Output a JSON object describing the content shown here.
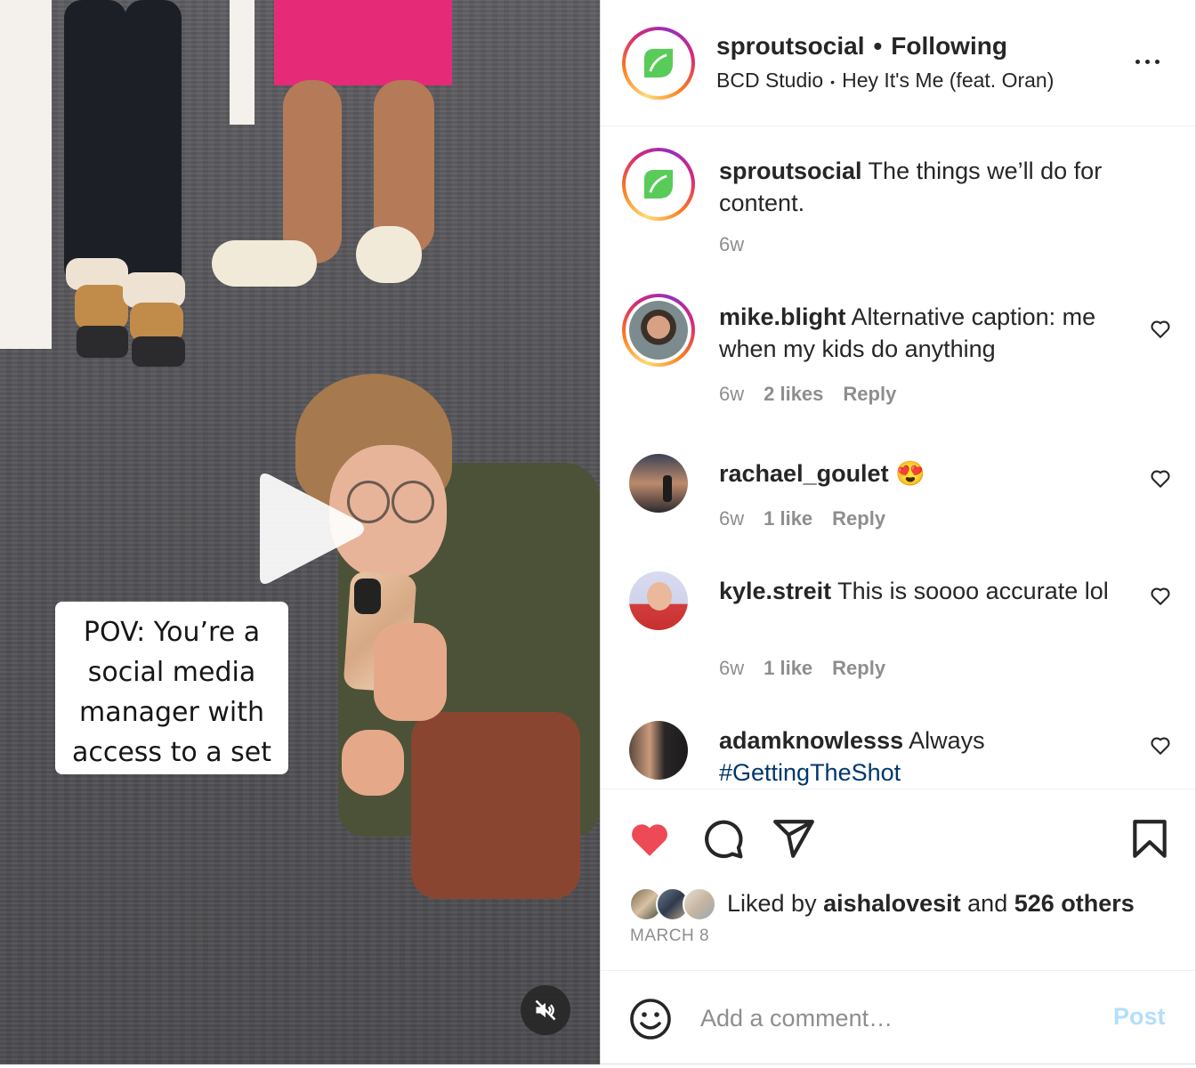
{
  "media": {
    "overlay_text": "POV: You’re a social media manager with access to a set",
    "play_icon": "play-icon",
    "mute_icon": "muted-speaker-icon"
  },
  "header": {
    "username": "sproutsocial",
    "separator": "•",
    "follow_status": "Following",
    "audio_artist": "BCD Studio",
    "audio_separator": "•",
    "audio_title": "Hey It's Me (feat. Oran)",
    "more_icon": "more-options-icon"
  },
  "caption": {
    "username": "sproutsocial",
    "text": " The things we’ll do for content.",
    "time": "6w"
  },
  "comments": [
    {
      "username": "mike.blight",
      "text": " Alternative caption: me when my kids do anything",
      "time": "6w",
      "likes": "2 likes",
      "reply": "Reply"
    },
    {
      "username": "rachael_goulet",
      "text": " 😍",
      "time": "6w",
      "likes": "1 like",
      "reply": "Reply"
    },
    {
      "username": "kyle.streit",
      "text": " This is soooo accurate lol",
      "time": "6w",
      "likes": "1 like",
      "reply": "Reply"
    },
    {
      "username": "adamknowlesss",
      "text": " Always ",
      "hashtag": "#GettingTheShot"
    }
  ],
  "actions": {
    "liked_prefix": "Liked by ",
    "liked_user": "aishalovesit",
    "liked_and": " and ",
    "liked_others": "526 others",
    "date": "MARCH 8"
  },
  "add_comment": {
    "placeholder": "Add a comment…",
    "post_label": "Post"
  },
  "colors": {
    "like_red": "#ed4956",
    "post_disabled_blue": "#b2dffc",
    "hashtag_blue": "#00376b",
    "sprout_green": "#59cb59"
  }
}
